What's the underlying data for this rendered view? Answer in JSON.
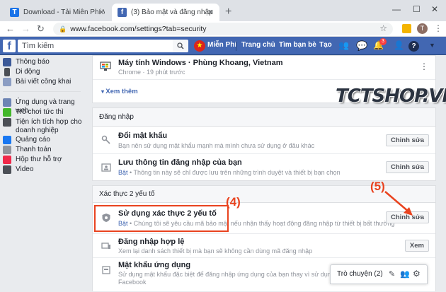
{
  "browser": {
    "tabs": [
      {
        "title": "Download - Tải Miễn Phí VN - Phầ",
        "icon": "t-favicon",
        "active": false
      },
      {
        "title": "(3) Bảo mật và đăng nhập",
        "icon": "facebook-favicon",
        "active": true
      }
    ],
    "url": "www.facebook.com/settings?tab=security"
  },
  "fb_header": {
    "search_placeholder": "Tìm kiếm",
    "user_name": "Miễn Phí",
    "nav": [
      "Trang chủ",
      "Tìm bạn bè",
      "Tạo"
    ],
    "notification_count": "3"
  },
  "sidebar": {
    "group1": [
      "Thông báo",
      "Di động",
      "Bài viết công khai"
    ],
    "group2": [
      "Ứng dụng và trang web",
      "Trò chơi tức thì",
      "Tiện ích tích hợp cho doanh nghiệp",
      "Quảng cáo",
      "Thanh toán",
      "Hộp thư hỗ trợ",
      "Video"
    ]
  },
  "devices": {
    "device_title": "Máy tính Windows · Phùng Khoang, Vietnam",
    "device_desc": "Chrome · 19 phút trước",
    "see_more": "Xem thêm"
  },
  "login": {
    "header": "Đăng nhập",
    "rows": [
      {
        "title": "Đổi mật khẩu",
        "desc": "Bạn nên sử dụng mật khẩu mạnh mà mình chưa sử dụng ở đâu khác",
        "button": "Chỉnh sửa",
        "status": ""
      },
      {
        "title": "Lưu thông tin đăng nhập của bạn",
        "status": "Bật",
        "desc": " • Thông tin này sẽ chỉ được lưu trên những trình duyệt và thiết bị bạn chọn",
        "button": "Chỉnh sửa"
      }
    ]
  },
  "twofa": {
    "header": "Xác thực 2 yếu tố",
    "rows": [
      {
        "title": "Sử dụng xác thực 2 yếu tố",
        "status": "Bật",
        "desc": " • Chúng tôi sẽ yêu cầu mã bảo mật nếu nhận thấy hoạt động đăng nhập từ thiết bị bất thường",
        "button": "Chỉnh sửa"
      },
      {
        "title": "Đăng nhập hợp lệ",
        "desc": "Xem lại danh sách thiết bị mà bạn sẽ không cần dùng mã đăng nhập",
        "button": "Xem",
        "status": ""
      },
      {
        "title": "Mật khẩu ứng dụng",
        "desc": "Sử dụng mật khẩu đặc biệt để đăng nhập ứng dụng của bạn thay vì sử dụng mật khẩu Facebook",
        "desc2": "Facebook",
        "status": ""
      }
    ]
  },
  "annotations": {
    "step4": "(4)",
    "step5": "(5)",
    "watermark": "TCTSHOP.VN"
  },
  "chat": {
    "label": "Trò chuyện (2)"
  },
  "colors": {
    "fb_blue": "#4267b2",
    "annotation": "#e9431f"
  }
}
